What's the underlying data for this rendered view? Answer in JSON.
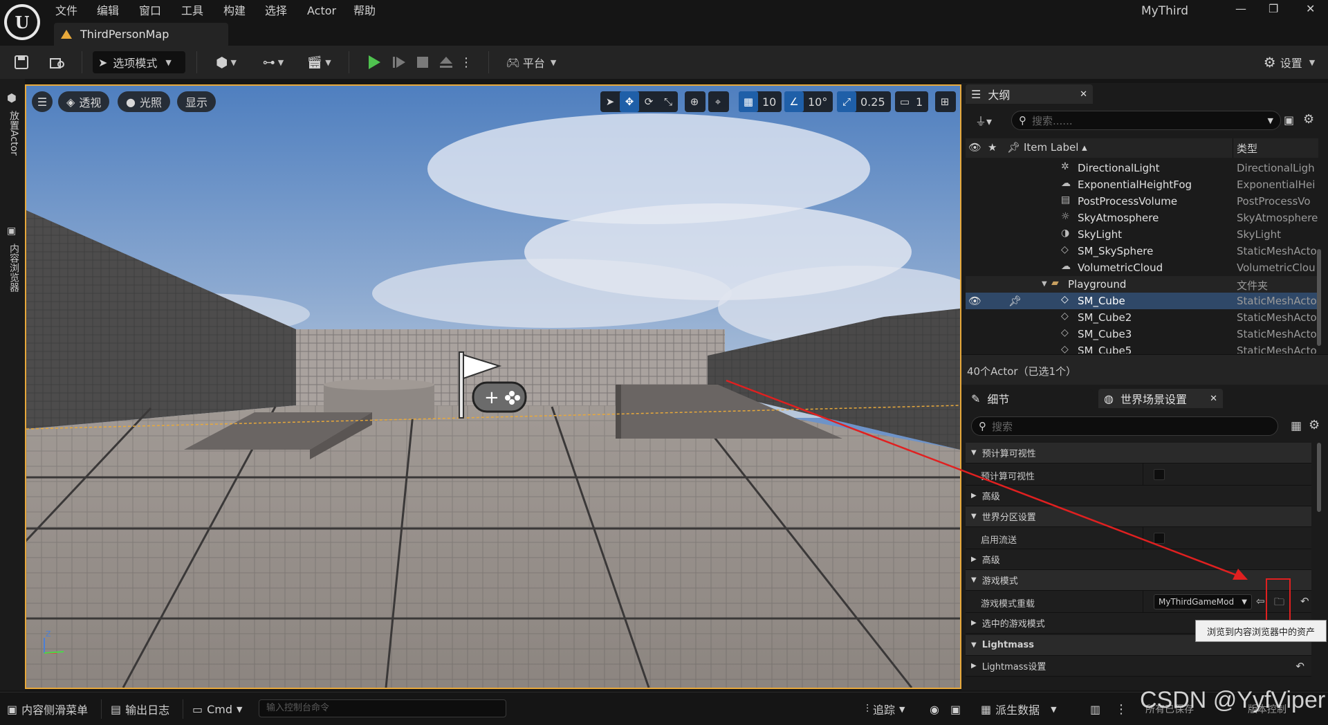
{
  "menu": {
    "items": [
      "文件",
      "编辑",
      "窗口",
      "工具",
      "构建",
      "选择",
      "Actor",
      "帮助"
    ],
    "map_tab": "ThirdPersonMap",
    "app_title": "MyThird"
  },
  "toolbar": {
    "mode_label": "选项模式",
    "platform_label": "平台",
    "settings_label": "设置"
  },
  "left_rail": {
    "place_actor": "放置Actor",
    "content_browser": "内容浏览器"
  },
  "viewport": {
    "menu_icon": "hamburger-icon",
    "perspective": "透视",
    "lighting": "光照",
    "show": "显示",
    "grid_snap": "10",
    "rotation_snap": "10°",
    "scale_snap": "0.25",
    "camera_speed": "1"
  },
  "outliner": {
    "tab_title": "大纲",
    "search_placeholder": "搜索......",
    "col_label": "Item Label",
    "col_type": "类型",
    "rows": [
      {
        "label": "DirectionalLight",
        "type": "DirectionalLigh",
        "icon": "directional-light-icon"
      },
      {
        "label": "ExponentialHeightFog",
        "type": "ExponentialHei",
        "icon": "fog-icon"
      },
      {
        "label": "PostProcessVolume",
        "type": "PostProcessVo",
        "icon": "post-process-icon"
      },
      {
        "label": "SkyAtmosphere",
        "type": "SkyAtmosphere",
        "icon": "sky-atmosphere-icon"
      },
      {
        "label": "SkyLight",
        "type": "SkyLight",
        "icon": "skylight-icon"
      },
      {
        "label": "SM_SkySphere",
        "type": "StaticMeshActo",
        "icon": "static-mesh-icon"
      },
      {
        "label": "VolumetricCloud",
        "type": "VolumetricClou",
        "icon": "cloud-icon"
      },
      {
        "label": "Playground",
        "type": "文件夹",
        "icon": "folder-icon"
      },
      {
        "label": "SM_Cube",
        "type": "StaticMeshActo",
        "icon": "static-mesh-icon"
      },
      {
        "label": "SM_Cube2",
        "type": "StaticMeshActo",
        "icon": "static-mesh-icon"
      },
      {
        "label": "SM_Cube3",
        "type": "StaticMeshActo",
        "icon": "static-mesh-icon"
      },
      {
        "label": "SM_Cube5",
        "type": "StaticMeshActo",
        "icon": "static-mesh-icon"
      }
    ],
    "actor_count": "40个Actor（已选1个）"
  },
  "details": {
    "tab_details": "细节",
    "tab_world": "世界场景设置",
    "search_placeholder": "搜索",
    "cat_precomputed": "预计算可视性",
    "prop_precomputed": "预计算可视性",
    "cat_advanced1": "高级",
    "cat_world_partition": "世界分区设置",
    "prop_streaming": "启用流送",
    "cat_advanced2": "高级",
    "cat_game_mode": "游戏模式",
    "prop_game_mode_override": "游戏模式重载",
    "game_mode_value": "MyThirdGameMod",
    "prop_selected_game_mode": "选中的游戏模式",
    "cat_lightmass": "Lightmass",
    "prop_lightmass_settings": "Lightmass设置",
    "tooltip": "浏览到内容浏览器中的资产"
  },
  "statusbar": {
    "content_drawer": "内容侧滑菜单",
    "output_log": "输出日志",
    "cmd": "Cmd",
    "cmd_placeholder": "输入控制台命令",
    "trace": "追踪",
    "derived_data": "派生数据",
    "save_all": "所有已保存",
    "revision": "版本控制"
  },
  "watermark": "CSDN @YyfViper",
  "colors": {
    "accent_orange": "#e8a93b",
    "selection_blue": "#2f4868",
    "play_green": "#4fc24f",
    "arrow_red": "#e02020"
  }
}
